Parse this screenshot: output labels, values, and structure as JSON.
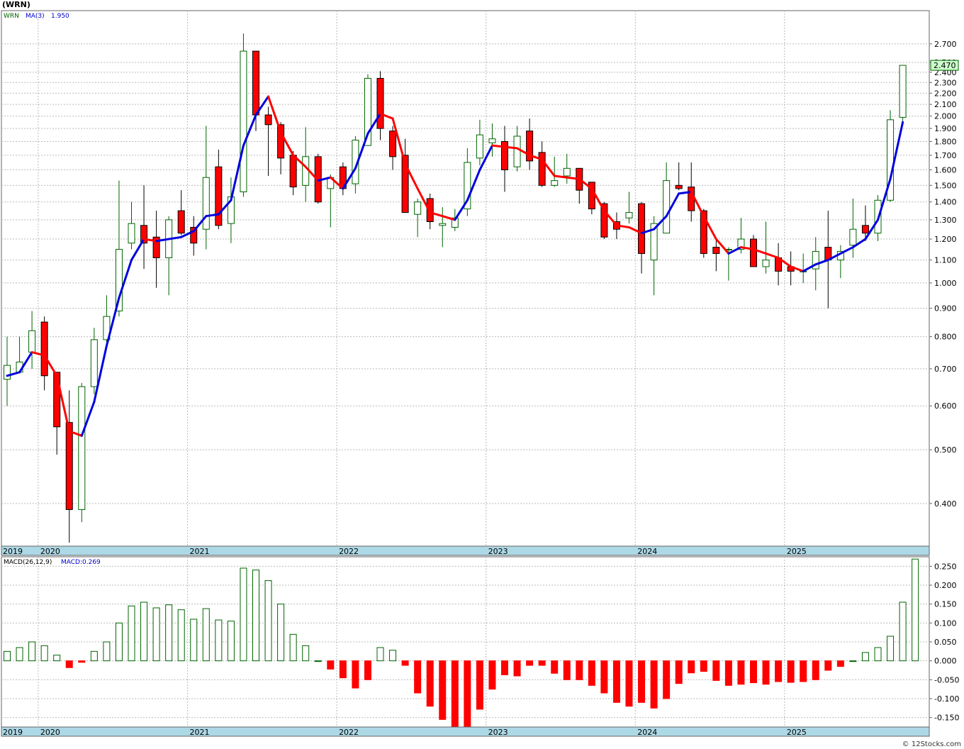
{
  "page_title": "(WRN)",
  "watermark": "© 12Stocks.com",
  "colors": {
    "up": "#006400",
    "down": "#ff0000",
    "ma_up": "#0000dd",
    "ma_down": "#ff0000",
    "axis_band": "#add8e6",
    "grid": "#bbbbbb",
    "price_box": "#ccffcc"
  },
  "chart_data": [
    {
      "type": "candlestick",
      "legend": {
        "symbol": "WRN",
        "ma_label": "MA(3)",
        "ma_value": "1.950"
      },
      "last_price_label": "2.470",
      "scale": "log",
      "ylim": [
        0.335,
        3.1
      ],
      "y_ticks": [
        {
          "v": 2.7,
          "label": "2.700"
        },
        {
          "v": 2.5,
          "label": "2.500"
        },
        {
          "v": 2.4,
          "label": "2.400"
        },
        {
          "v": 2.3,
          "label": "2.300"
        },
        {
          "v": 2.2,
          "label": "2.200"
        },
        {
          "v": 2.1,
          "label": "2.100"
        },
        {
          "v": 2.0,
          "label": "2.000"
        },
        {
          "v": 1.9,
          "label": "1.900"
        },
        {
          "v": 1.8,
          "label": "1.800"
        },
        {
          "v": 1.7,
          "label": "1.700"
        },
        {
          "v": 1.6,
          "label": "1.600"
        },
        {
          "v": 1.5,
          "label": "1.500"
        },
        {
          "v": 1.4,
          "label": "1.400"
        },
        {
          "v": 1.3,
          "label": "1.300"
        },
        {
          "v": 1.2,
          "label": "1.200"
        },
        {
          "v": 1.1,
          "label": "1.100"
        },
        {
          "v": 1.0,
          "label": "1.000"
        },
        {
          "v": 0.9,
          "label": "0.900"
        },
        {
          "v": 0.8,
          "label": "0.800"
        },
        {
          "v": 0.7,
          "label": "0.700"
        },
        {
          "v": 0.6,
          "label": "0.600"
        },
        {
          "v": 0.5,
          "label": "0.500"
        },
        {
          "v": 0.4,
          "label": "0.400"
        }
      ],
      "x_labels": [
        {
          "i": 0,
          "label": "2019"
        },
        {
          "i": 3,
          "label": "2020"
        },
        {
          "i": 15,
          "label": "2021"
        },
        {
          "i": 27,
          "label": "2022"
        },
        {
          "i": 39,
          "label": "2023"
        },
        {
          "i": 51,
          "label": "2024"
        },
        {
          "i": 63,
          "label": "2025"
        }
      ],
      "candles": [
        {
          "o": 0.67,
          "h": 0.8,
          "l": 0.6,
          "c": 0.71
        },
        {
          "o": 0.69,
          "h": 0.8,
          "l": 0.69,
          "c": 0.72
        },
        {
          "o": 0.75,
          "h": 0.89,
          "l": 0.7,
          "c": 0.82
        },
        {
          "o": 0.85,
          "h": 0.87,
          "l": 0.64,
          "c": 0.68
        },
        {
          "o": 0.69,
          "h": 0.69,
          "l": 0.49,
          "c": 0.55
        },
        {
          "o": 0.56,
          "h": 0.64,
          "l": 0.34,
          "c": 0.39
        },
        {
          "o": 0.39,
          "h": 0.66,
          "l": 0.37,
          "c": 0.65
        },
        {
          "o": 0.65,
          "h": 0.83,
          "l": 0.63,
          "c": 0.79
        },
        {
          "o": 0.79,
          "h": 0.95,
          "l": 0.78,
          "c": 0.87
        },
        {
          "o": 0.89,
          "h": 1.53,
          "l": 0.87,
          "c": 1.15
        },
        {
          "o": 1.18,
          "h": 1.4,
          "l": 1.15,
          "c": 1.28
        },
        {
          "o": 1.27,
          "h": 1.5,
          "l": 1.06,
          "c": 1.18
        },
        {
          "o": 1.21,
          "h": 1.35,
          "l": 0.98,
          "c": 1.11
        },
        {
          "o": 1.11,
          "h": 1.32,
          "l": 0.95,
          "c": 1.3
        },
        {
          "o": 1.35,
          "h": 1.47,
          "l": 1.22,
          "c": 1.23
        },
        {
          "o": 1.26,
          "h": 1.32,
          "l": 1.12,
          "c": 1.18
        },
        {
          "o": 1.25,
          "h": 1.92,
          "l": 1.15,
          "c": 1.55
        },
        {
          "o": 1.62,
          "h": 1.74,
          "l": 1.25,
          "c": 1.27
        },
        {
          "o": 1.28,
          "h": 1.55,
          "l": 1.18,
          "c": 1.43
        },
        {
          "o": 1.46,
          "h": 2.82,
          "l": 1.43,
          "c": 2.62
        },
        {
          "o": 2.62,
          "h": 2.62,
          "l": 1.88,
          "c": 2.01
        },
        {
          "o": 2.01,
          "h": 2.08,
          "l": 1.56,
          "c": 1.93
        },
        {
          "o": 1.93,
          "h": 1.95,
          "l": 1.57,
          "c": 1.68
        },
        {
          "o": 1.7,
          "h": 1.73,
          "l": 1.44,
          "c": 1.49
        },
        {
          "o": 1.5,
          "h": 1.91,
          "l": 1.4,
          "c": 1.69
        },
        {
          "o": 1.69,
          "h": 1.71,
          "l": 1.39,
          "c": 1.4
        },
        {
          "o": 1.48,
          "h": 1.57,
          "l": 1.26,
          "c": 1.55
        },
        {
          "o": 1.62,
          "h": 1.65,
          "l": 1.44,
          "c": 1.48
        },
        {
          "o": 1.51,
          "h": 1.84,
          "l": 1.45,
          "c": 1.81
        },
        {
          "o": 1.77,
          "h": 2.38,
          "l": 1.77,
          "c": 2.34
        },
        {
          "o": 2.34,
          "h": 2.41,
          "l": 1.81,
          "c": 1.9
        },
        {
          "o": 1.88,
          "h": 1.92,
          "l": 1.6,
          "c": 1.69
        },
        {
          "o": 1.7,
          "h": 1.82,
          "l": 1.34,
          "c": 1.34
        },
        {
          "o": 1.33,
          "h": 1.42,
          "l": 1.21,
          "c": 1.4
        },
        {
          "o": 1.42,
          "h": 1.45,
          "l": 1.25,
          "c": 1.29
        },
        {
          "o": 1.27,
          "h": 1.37,
          "l": 1.16,
          "c": 1.28
        },
        {
          "o": 1.26,
          "h": 1.36,
          "l": 1.24,
          "c": 1.31
        },
        {
          "o": 1.36,
          "h": 1.75,
          "l": 1.32,
          "c": 1.65
        },
        {
          "o": 1.68,
          "h": 1.97,
          "l": 1.63,
          "c": 1.85
        },
        {
          "o": 1.79,
          "h": 1.94,
          "l": 1.69,
          "c": 1.82
        },
        {
          "o": 1.8,
          "h": 1.92,
          "l": 1.46,
          "c": 1.6
        },
        {
          "o": 1.62,
          "h": 1.92,
          "l": 1.59,
          "c": 1.84
        },
        {
          "o": 1.88,
          "h": 1.98,
          "l": 1.6,
          "c": 1.66
        },
        {
          "o": 1.72,
          "h": 1.8,
          "l": 1.49,
          "c": 1.5
        },
        {
          "o": 1.5,
          "h": 1.69,
          "l": 1.49,
          "c": 1.53
        },
        {
          "o": 1.56,
          "h": 1.71,
          "l": 1.51,
          "c": 1.61
        },
        {
          "o": 1.61,
          "h": 1.61,
          "l": 1.39,
          "c": 1.47
        },
        {
          "o": 1.52,
          "h": 1.52,
          "l": 1.33,
          "c": 1.36
        },
        {
          "o": 1.39,
          "h": 1.4,
          "l": 1.2,
          "c": 1.21
        },
        {
          "o": 1.29,
          "h": 1.34,
          "l": 1.2,
          "c": 1.25
        },
        {
          "o": 1.31,
          "h": 1.46,
          "l": 1.28,
          "c": 1.34
        },
        {
          "o": 1.39,
          "h": 1.4,
          "l": 1.04,
          "c": 1.13
        },
        {
          "o": 1.1,
          "h": 1.32,
          "l": 0.95,
          "c": 1.28
        },
        {
          "o": 1.23,
          "h": 1.65,
          "l": 1.23,
          "c": 1.53
        },
        {
          "o": 1.5,
          "h": 1.65,
          "l": 1.47,
          "c": 1.48
        },
        {
          "o": 1.49,
          "h": 1.65,
          "l": 1.29,
          "c": 1.35
        },
        {
          "o": 1.35,
          "h": 1.36,
          "l": 1.11,
          "c": 1.13
        },
        {
          "o": 1.16,
          "h": 1.2,
          "l": 1.05,
          "c": 1.13
        },
        {
          "o": 1.15,
          "h": 1.16,
          "l": 1.01,
          "c": 1.15
        },
        {
          "o": 1.15,
          "h": 1.31,
          "l": 1.13,
          "c": 1.2
        },
        {
          "o": 1.2,
          "h": 1.22,
          "l": 1.07,
          "c": 1.07
        },
        {
          "o": 1.07,
          "h": 1.29,
          "l": 1.04,
          "c": 1.1
        },
        {
          "o": 1.11,
          "h": 1.18,
          "l": 0.99,
          "c": 1.05
        },
        {
          "o": 1.07,
          "h": 1.14,
          "l": 0.99,
          "c": 1.05
        },
        {
          "o": 1.05,
          "h": 1.13,
          "l": 1.0,
          "c": 1.05
        },
        {
          "o": 1.06,
          "h": 1.21,
          "l": 0.97,
          "c": 1.14
        },
        {
          "o": 1.16,
          "h": 1.35,
          "l": 0.9,
          "c": 1.1
        },
        {
          "o": 1.1,
          "h": 1.17,
          "l": 1.02,
          "c": 1.14
        },
        {
          "o": 1.17,
          "h": 1.42,
          "l": 1.11,
          "c": 1.25
        },
        {
          "o": 1.27,
          "h": 1.38,
          "l": 1.19,
          "c": 1.23
        },
        {
          "o": 1.23,
          "h": 1.44,
          "l": 1.19,
          "c": 1.41
        },
        {
          "o": 1.41,
          "h": 2.05,
          "l": 1.4,
          "c": 1.97
        },
        {
          "o": 1.99,
          "h": 2.47,
          "l": 1.95,
          "c": 2.47
        }
      ],
      "ma": [
        0.68,
        0.69,
        0.75,
        0.74,
        0.68,
        0.54,
        0.53,
        0.61,
        0.77,
        0.94,
        1.1,
        1.2,
        1.19,
        1.2,
        1.21,
        1.24,
        1.32,
        1.33,
        1.41,
        1.77,
        2.01,
        2.17,
        1.87,
        1.7,
        1.62,
        1.53,
        1.55,
        1.48,
        1.61,
        1.86,
        2.02,
        1.98,
        1.64,
        1.48,
        1.34,
        1.32,
        1.3,
        1.41,
        1.6,
        1.77,
        1.76,
        1.75,
        1.7,
        1.67,
        1.56,
        1.55,
        1.54,
        1.48,
        1.35,
        1.27,
        1.26,
        1.23,
        1.25,
        1.32,
        1.45,
        1.46,
        1.32,
        1.2,
        1.13,
        1.16,
        1.15,
        1.13,
        1.11,
        1.07,
        1.05,
        1.08,
        1.1,
        1.13,
        1.16,
        1.2,
        1.3,
        1.54,
        1.95
      ]
    },
    {
      "type": "bar",
      "label": "MACD(26,12,9)",
      "value_label": "MACD:0.269",
      "ylim": [
        -0.175,
        0.275
      ],
      "y_ticks": [
        {
          "v": 0.25,
          "label": "0.250"
        },
        {
          "v": 0.2,
          "label": "0.200"
        },
        {
          "v": 0.15,
          "label": "0.150"
        },
        {
          "v": 0.1,
          "label": "0.100"
        },
        {
          "v": 0.05,
          "label": "0.050"
        },
        {
          "v": 0.0,
          "label": "0.000"
        },
        {
          "v": -0.05,
          "label": "-0.050"
        },
        {
          "v": -0.1,
          "label": "-0.100"
        },
        {
          "v": -0.15,
          "label": "-0.150"
        }
      ],
      "values": [
        0.025,
        0.035,
        0.05,
        0.04,
        0.015,
        -0.018,
        -0.004,
        0.025,
        0.05,
        0.1,
        0.145,
        0.155,
        0.14,
        0.148,
        0.135,
        0.11,
        0.138,
        0.108,
        0.105,
        0.245,
        0.24,
        0.212,
        0.15,
        0.07,
        0.04,
        0.0,
        -0.022,
        -0.045,
        -0.072,
        -0.05,
        0.035,
        0.028,
        -0.012,
        -0.085,
        -0.12,
        -0.155,
        -0.175,
        -0.175,
        -0.128,
        -0.075,
        -0.037,
        -0.04,
        -0.012,
        -0.012,
        -0.033,
        -0.05,
        -0.05,
        -0.065,
        -0.085,
        -0.11,
        -0.12,
        -0.11,
        -0.125,
        -0.1,
        -0.06,
        -0.032,
        -0.028,
        -0.052,
        -0.065,
        -0.062,
        -0.058,
        -0.062,
        -0.055,
        -0.057,
        -0.055,
        -0.05,
        -0.025,
        -0.015,
        0.0,
        0.022,
        0.035,
        0.065,
        0.155,
        0.269
      ]
    }
  ]
}
